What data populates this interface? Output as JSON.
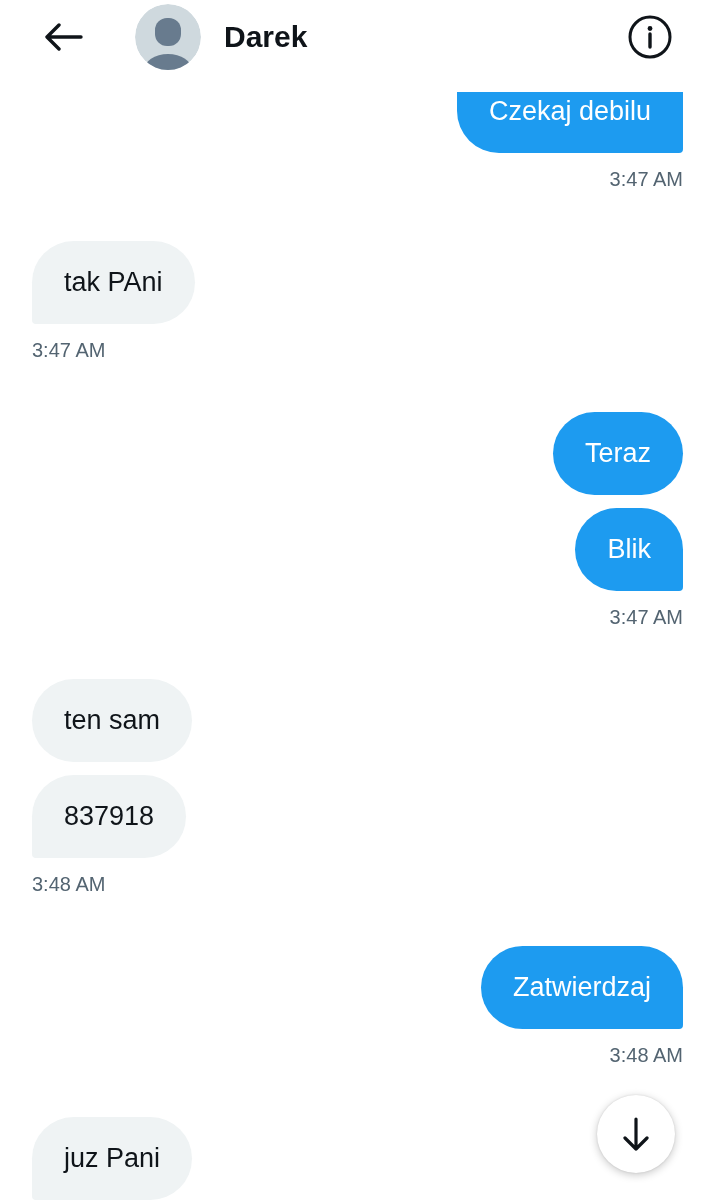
{
  "header": {
    "contact_name": "Darek"
  },
  "messages": [
    {
      "kind": "sent",
      "bubbles": [
        "Czekaj debilu"
      ],
      "time": "3:47 AM"
    },
    {
      "kind": "received",
      "bubbles": [
        "tak PAni"
      ],
      "time": "3:47 AM"
    },
    {
      "kind": "sent",
      "bubbles": [
        "Teraz",
        "Blik"
      ],
      "time": "3:47 AM"
    },
    {
      "kind": "received",
      "bubbles": [
        "ten sam",
        "837918"
      ],
      "time": "3:48 AM"
    },
    {
      "kind": "sent",
      "bubbles": [
        "Zatwierdzaj"
      ],
      "time": "3:48 AM"
    },
    {
      "kind": "received",
      "bubbles": [
        "juz Pani"
      ]
    }
  ]
}
